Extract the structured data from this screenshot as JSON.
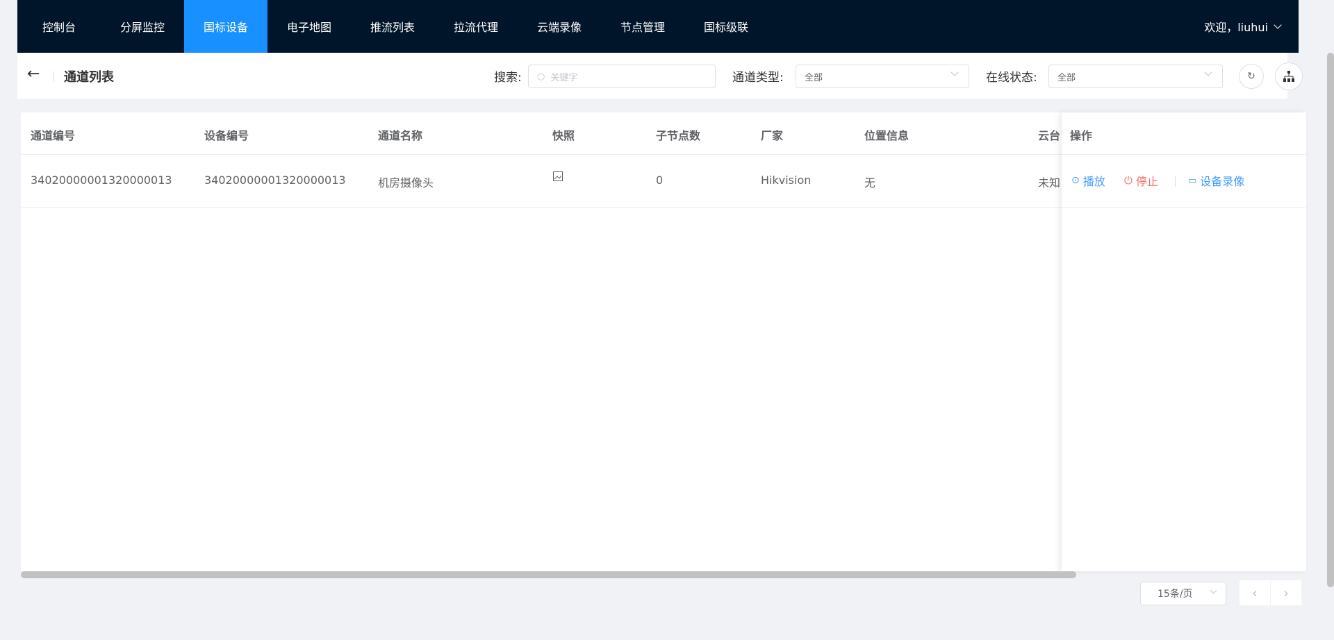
{
  "nav": {
    "items": [
      "控制台",
      "分屏监控",
      "国标设备",
      "电子地图",
      "推流列表",
      "拉流代理",
      "云端录像",
      "节点管理",
      "国标级联"
    ],
    "active_index": 2,
    "user": "欢迎，liuhui"
  },
  "header": {
    "title": "通道列表",
    "search_label": "搜索:",
    "search_placeholder": "关键字",
    "type_label": "通道类型:",
    "type_value": "全部",
    "status_label": "在线状态:",
    "status_value": "全部"
  },
  "table": {
    "columns": [
      "通道编号",
      "设备编号",
      "通道名称",
      "快照",
      "子节点数",
      "厂家",
      "位置信息",
      "云台",
      "操作"
    ],
    "rows": [
      {
        "channel_id": "34020000001320000013",
        "device_id": "34020000001320000013",
        "name": "机房摄像头",
        "children": "0",
        "vendor": "Hikvision",
        "location": "无",
        "ptz": "未知"
      }
    ],
    "actions": {
      "play": "播放",
      "stop": "停止",
      "record": "设备录像"
    }
  },
  "pagination": {
    "page_size": "15条/页"
  },
  "colors": {
    "nav_bg": "#001529",
    "active": "#1890ff",
    "link": "#409eff",
    "danger": "#f56c6c"
  }
}
